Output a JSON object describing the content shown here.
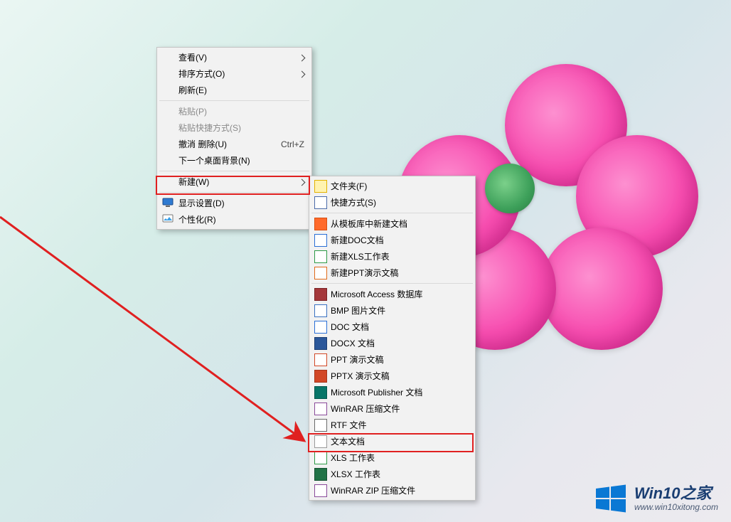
{
  "menu1": {
    "view": {
      "label": "查看(V)",
      "hasSubmenu": true
    },
    "sort": {
      "label": "排序方式(O)",
      "hasSubmenu": true
    },
    "refresh": {
      "label": "刷新(E)"
    },
    "paste": {
      "label": "粘贴(P)",
      "disabled": true
    },
    "paste_shortcut": {
      "label": "粘贴快捷方式(S)",
      "disabled": true
    },
    "undo": {
      "label": "撤消 删除(U)",
      "shortcut": "Ctrl+Z"
    },
    "next_bg": {
      "label": "下一个桌面背景(N)"
    },
    "new": {
      "label": "新建(W)",
      "hasSubmenu": true
    },
    "display": {
      "label": "显示设置(D)"
    },
    "personalize": {
      "label": "个性化(R)"
    }
  },
  "menu2": {
    "items": [
      {
        "id": "folder",
        "label": "文件夹(F)",
        "iconBg": "#fff3b0",
        "iconBorder": "#e2b200"
      },
      {
        "id": "shortcut",
        "label": "快捷方式(S)",
        "iconBg": "#ffffff",
        "iconBorder": "#4a6aa8"
      },
      {
        "sep": true
      },
      {
        "id": "wps-tpl",
        "label": "从模板库中新建文档",
        "iconBg": "#ff6a2b",
        "iconBorder": "#d94f10"
      },
      {
        "id": "wps-doc",
        "label": "新建DOC文档",
        "iconBg": "#ffffff",
        "iconBorder": "#2a6fd6"
      },
      {
        "id": "wps-xls",
        "label": "新建XLS工作表",
        "iconBg": "#ffffff",
        "iconBorder": "#2d9a46"
      },
      {
        "id": "wps-ppt",
        "label": "新建PPT演示文稿",
        "iconBg": "#ffffff",
        "iconBorder": "#e06a1a"
      },
      {
        "sep": true
      },
      {
        "id": "access",
        "label": "Microsoft Access 数据库",
        "iconBg": "#a4373a",
        "iconBorder": "#7a2224"
      },
      {
        "id": "bmp",
        "label": "BMP 图片文件",
        "iconBg": "#ffffff",
        "iconBorder": "#3a71c2"
      },
      {
        "id": "doc",
        "label": "DOC 文档",
        "iconBg": "#ffffff",
        "iconBorder": "#2a6fd6"
      },
      {
        "id": "docx",
        "label": "DOCX 文档",
        "iconBg": "#2b579a",
        "iconBorder": "#1d3e73"
      },
      {
        "id": "ppt",
        "label": "PPT 演示文稿",
        "iconBg": "#ffffff",
        "iconBorder": "#d24726"
      },
      {
        "id": "pptx",
        "label": "PPTX 演示文稿",
        "iconBg": "#d24726",
        "iconBorder": "#a6351a"
      },
      {
        "id": "pub",
        "label": "Microsoft Publisher 文档",
        "iconBg": "#077568",
        "iconBorder": "#05574d"
      },
      {
        "id": "rar",
        "label": "WinRAR 压缩文件",
        "iconBg": "#ffffff",
        "iconBorder": "#8a4a9a"
      },
      {
        "id": "rtf",
        "label": "RTF 文件",
        "iconBg": "#ffffff",
        "iconBorder": "#6a6a6a"
      },
      {
        "id": "txt",
        "label": "文本文档",
        "iconBg": "#ffffff",
        "iconBorder": "#9a9a9a",
        "highlight": true
      },
      {
        "id": "xls",
        "label": "XLS 工作表",
        "iconBg": "#ffffff",
        "iconBorder": "#2d9a46"
      },
      {
        "id": "xlsx",
        "label": "XLSX 工作表",
        "iconBg": "#217346",
        "iconBorder": "#165232"
      },
      {
        "id": "zip",
        "label": "WinRAR ZIP 压缩文件",
        "iconBg": "#ffffff",
        "iconBorder": "#8a4a9a"
      }
    ]
  },
  "watermark": {
    "title": "Win10之家",
    "url": "www.win10xitong.com"
  }
}
